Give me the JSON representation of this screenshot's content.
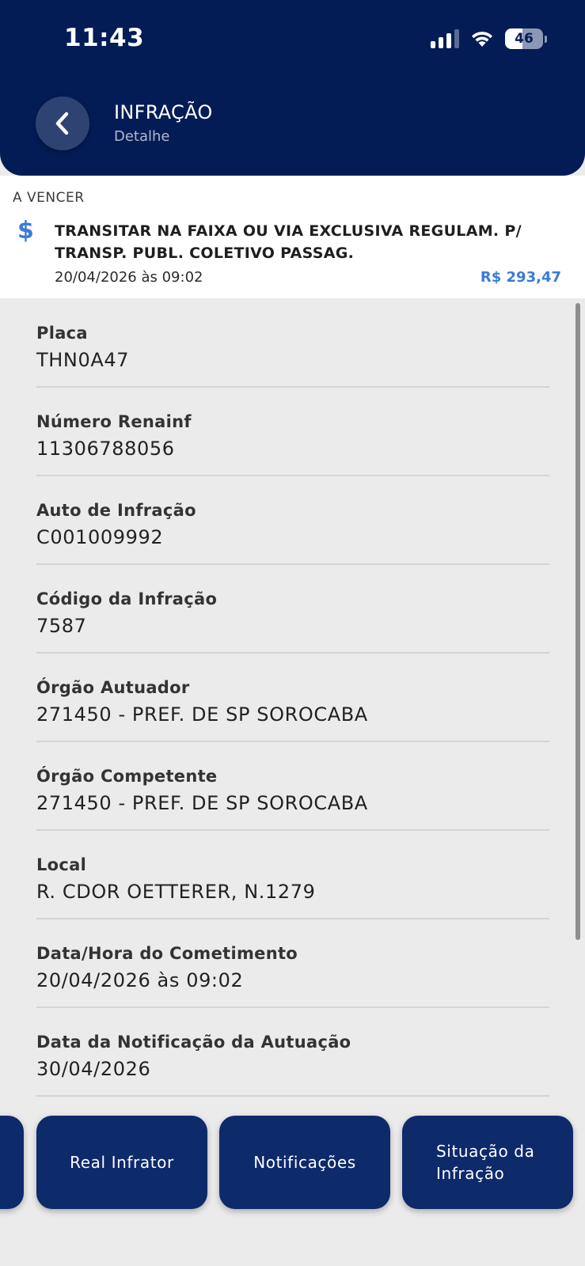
{
  "status_bar": {
    "time": "11:43",
    "battery_percent": "46",
    "battery_level": 0.46,
    "signal_bars_active": 3,
    "signal_bars_total": 4
  },
  "header": {
    "title": "INFRAÇÃO",
    "subtitle": "Detalhe",
    "back_icon": "chevron-left-icon"
  },
  "summary": {
    "status": "A VENCER",
    "currency_icon": "$",
    "description": "TRANSITAR NA FAIXA OU VIA EXCLUSIVA REGULAM. P/ TRANSP. PUBL. COLETIVO PASSAG.",
    "datetime": "20/04/2026 às 09:02",
    "amount": "R$ 293,47"
  },
  "details": [
    {
      "label": "Placa",
      "value": "THN0A47"
    },
    {
      "label": "Número Renainf",
      "value": "11306788056"
    },
    {
      "label": "Auto de Infração",
      "value": "C001009992"
    },
    {
      "label": "Código da Infração",
      "value": "7587"
    },
    {
      "label": "Órgão Autuador",
      "value": "271450 - PREF. DE SP SOROCABA"
    },
    {
      "label": "Órgão Competente",
      "value": "271450 - PREF. DE SP SOROCABA"
    },
    {
      "label": "Local",
      "value": "R. CDOR OETTERER, N.1279"
    },
    {
      "label": "Data/Hora do Cometimento",
      "value": "20/04/2026 às 09:02"
    },
    {
      "label": "Data da Notificação da Autuação",
      "value": "30/04/2026"
    }
  ],
  "actions": {
    "real_infrator": "Real Infrator",
    "notificacoes": "Notificações",
    "situacao": "Situação da Infração"
  },
  "colors": {
    "header_bg": "#041c55",
    "button_bg": "#0d2a6b",
    "accent": "#3a7bd5",
    "page_bg": "#ebebeb"
  }
}
